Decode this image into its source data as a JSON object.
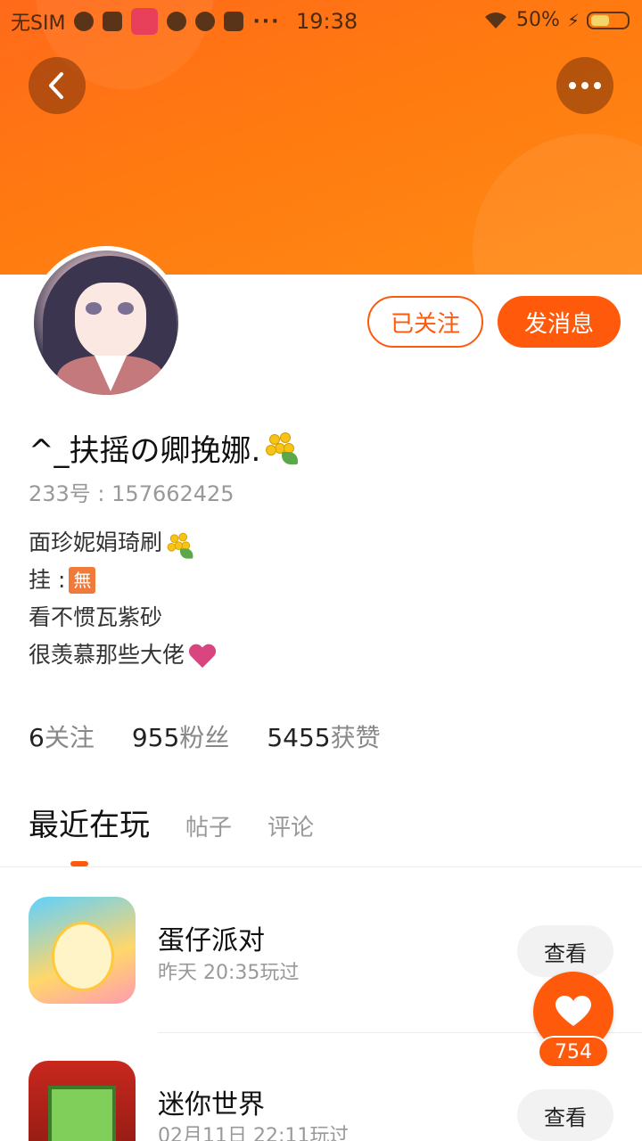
{
  "status_bar": {
    "carrier": "无SIM",
    "time": "19:38",
    "battery": "50%",
    "icons": [
      "play-icon",
      "mail-icon",
      "music-icon",
      "game-icon",
      "planet-icon",
      "s-icon",
      "more-dots"
    ]
  },
  "header": {
    "back_icon": "chevron-left-icon",
    "more_icon": "more-dots-icon"
  },
  "profile": {
    "username": "^_扶摇の卿挽娜.",
    "uid": "233号 : 157662425",
    "bio": {
      "line1": "面珍妮娟琦刷",
      "line2_prefix": "挂 : ",
      "line2_badge": "無",
      "line3": "看不惯瓦紫砂",
      "line4": "很羡慕那些大佬"
    },
    "followed_label": "已关注",
    "message_label": "发消息"
  },
  "stats": {
    "following_count": "6",
    "following_label": "关注",
    "fans_count": "955",
    "fans_label": "粉丝",
    "likes_count": "5455",
    "likes_label": "获赞"
  },
  "tabs": {
    "recent": "最近在玩",
    "posts": "帖子",
    "comments": "评论"
  },
  "games": [
    {
      "name": "蛋仔派对",
      "time": "昨天 20:35玩过",
      "action": "查看"
    },
    {
      "name": "迷你世界",
      "time": "02月11日 22:11玩过",
      "action": "查看"
    }
  ],
  "like_fab": {
    "count": "754"
  },
  "colors": {
    "accent": "#ff5a0c",
    "banner": "#ff7a10"
  }
}
